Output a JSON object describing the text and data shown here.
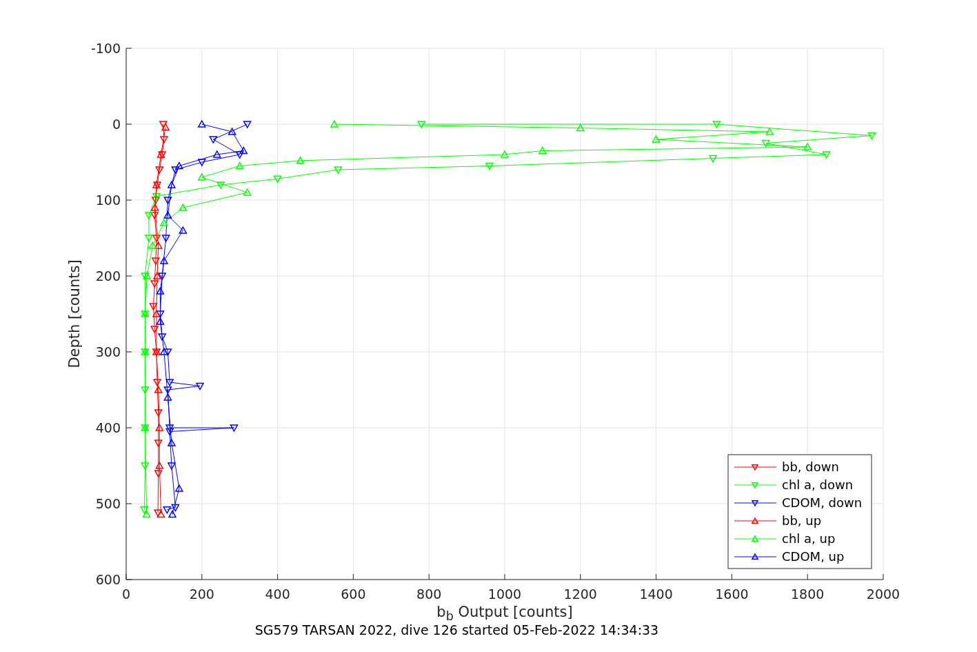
{
  "chart_data": {
    "type": "line",
    "title": "SG579 TARSAN 2022, dive 126 started 05-Feb-2022 14:34:33",
    "xlabel": "b$_{b}$ Output [counts]",
    "ylabel": "Depth [counts]",
    "xlim": [
      0,
      2000
    ],
    "ylim": [
      600,
      -100
    ],
    "xticks": [
      0,
      200,
      400,
      600,
      800,
      1000,
      1200,
      1400,
      1600,
      1800,
      2000
    ],
    "yticks": [
      -100,
      0,
      100,
      200,
      300,
      400,
      500,
      600
    ],
    "grid": true,
    "legend": true,
    "series": [
      {
        "name": "bb, down",
        "color": "#ff0000",
        "marker": "triangle",
        "x": [
          98,
          100,
          95,
          88,
          82,
          78,
          75,
          80,
          78,
          75,
          72,
          75,
          80,
          82,
          85,
          85,
          85,
          84
        ],
        "values": [
          0,
          20,
          40,
          60,
          80,
          100,
          120,
          150,
          180,
          210,
          240,
          270,
          300,
          340,
          380,
          420,
          460,
          512
        ]
      },
      {
        "name": "chl a, down",
        "color": "#00ff00",
        "marker": "triangle",
        "x": [
          780,
          1560,
          1970,
          1690,
          1850,
          1550,
          960,
          560,
          400,
          250,
          80,
          60,
          60,
          50,
          50,
          50,
          50,
          50,
          50,
          48
        ],
        "values": [
          0,
          0,
          15,
          25,
          40,
          45,
          55,
          60,
          72,
          80,
          95,
          120,
          150,
          200,
          250,
          300,
          350,
          400,
          450,
          508
        ]
      },
      {
        "name": "CDOM, down",
        "color": "#0000ff",
        "marker": "triangle",
        "x": [
          320,
          230,
          300,
          200,
          130,
          110,
          105,
          95,
          90,
          95,
          110,
          115,
          195,
          110,
          115,
          285,
          115,
          120,
          130,
          108
        ],
        "values": [
          0,
          20,
          40,
          50,
          60,
          100,
          150,
          200,
          250,
          280,
          300,
          340,
          345,
          350,
          400,
          400,
          405,
          450,
          505,
          508
        ]
      },
      {
        "name": "bb, up",
        "color": "#ff0000",
        "marker": "triangle",
        "x": [
          104,
          92,
          80,
          76,
          85,
          82,
          80,
          80,
          85,
          88,
          88,
          92
        ],
        "values": [
          4,
          40,
          80,
          110,
          160,
          200,
          250,
          300,
          350,
          400,
          450,
          514
        ]
      },
      {
        "name": "chl a, up",
        "color": "#00ff00",
        "marker": "triangle",
        "x": [
          550,
          1200,
          1700,
          1400,
          1800,
          1100,
          1000,
          460,
          300,
          200,
          320,
          150,
          100,
          70,
          55,
          50,
          50,
          50,
          54
        ],
        "values": [
          0,
          5,
          10,
          20,
          30,
          35,
          40,
          48,
          55,
          70,
          90,
          110,
          130,
          160,
          200,
          250,
          300,
          400,
          514
        ]
      },
      {
        "name": "CDOM, up",
        "color": "#0000ff",
        "marker": "triangle",
        "x": [
          200,
          280,
          310,
          240,
          140,
          120,
          110,
          150,
          100,
          90,
          90,
          100,
          110,
          120,
          140,
          122
        ],
        "values": [
          0,
          10,
          35,
          40,
          55,
          80,
          120,
          140,
          180,
          220,
          260,
          300,
          360,
          420,
          480,
          514
        ]
      }
    ]
  }
}
